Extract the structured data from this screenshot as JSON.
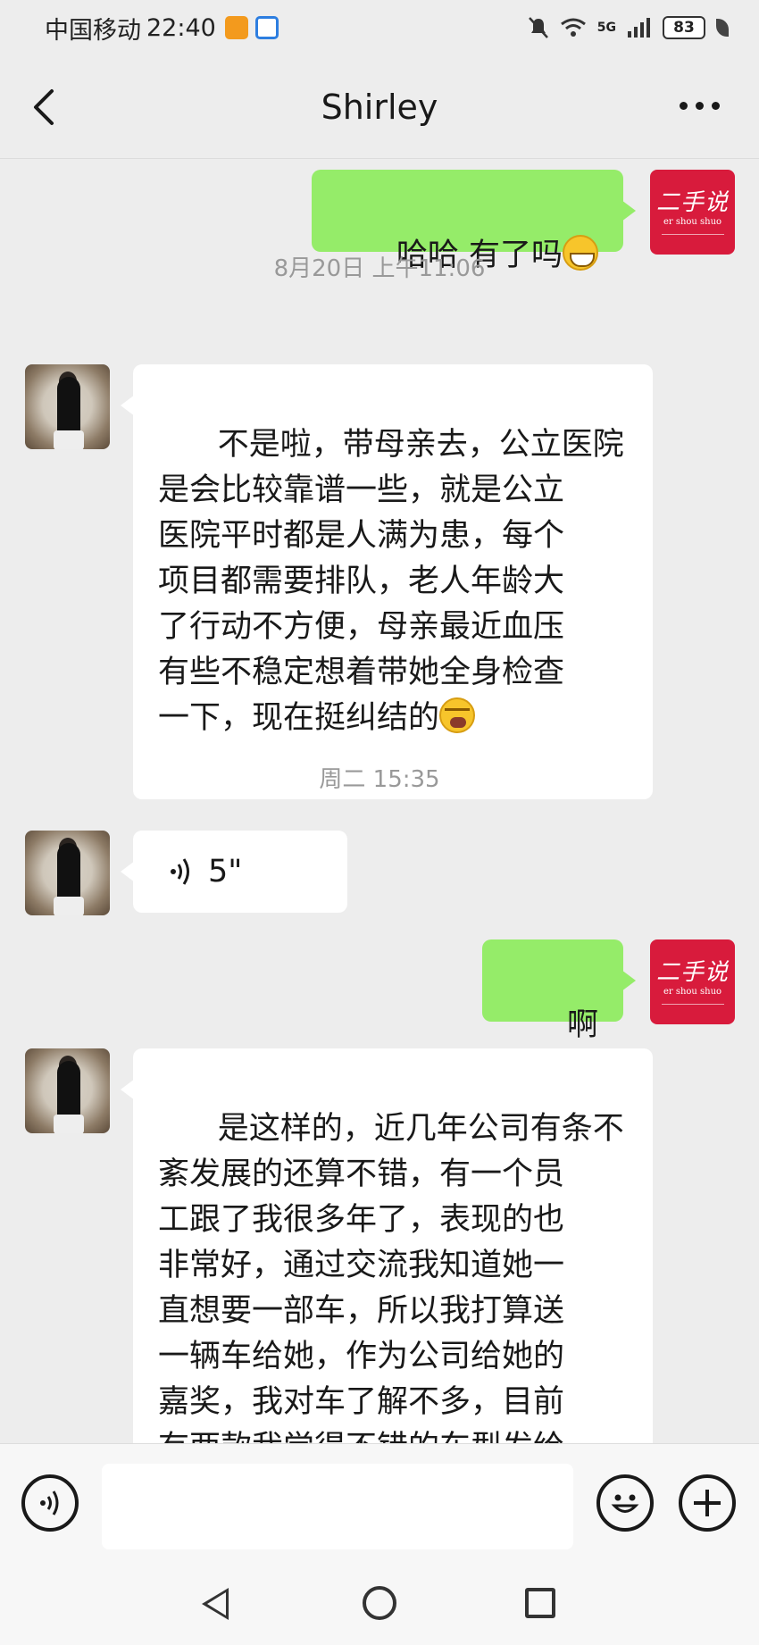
{
  "status_bar": {
    "carrier": "中国移动",
    "time": "22:40",
    "network": "5G",
    "battery": "83"
  },
  "header": {
    "title": "Shirley"
  },
  "brand_avatar": {
    "text_main": "二手说",
    "text_sub": "er shou shuo"
  },
  "messages": [
    {
      "id": "m1",
      "side": "me",
      "type": "text",
      "text": "哈哈 有了吗",
      "emoji": "grin-icon"
    },
    {
      "id": "t1",
      "type": "timestamp",
      "text": "8月20日 上午11:06"
    },
    {
      "id": "m2",
      "side": "them",
      "type": "text",
      "text": "不是啦，带母亲去，公立医院\n是会比较靠谱一些，就是公立\n医院平时都是人满为患，每个\n项目都需要排队，老人年龄大\n了行动不方便，母亲最近血压\n有些不稳定想着带她全身检查\n一下，现在挺纠结的",
      "emoji": "cry-icon"
    },
    {
      "id": "t2",
      "type": "timestamp",
      "text": "周二 15:35"
    },
    {
      "id": "m3",
      "side": "them",
      "type": "voice",
      "duration": "5\""
    },
    {
      "id": "m4",
      "side": "me",
      "type": "text",
      "text": "啊"
    },
    {
      "id": "m5",
      "side": "them",
      "type": "text",
      "text": "是这样的，近几年公司有条不\n紊发展的还算不错，有一个员\n工跟了我很多年了，表现的也\n非常好，通过交流我知道她一\n直想要一部车，所以我打算送\n一辆车给她，作为公司给她的\n嘉奖，我对车了解不多，目前\n有两款我觉得不错的车型发给\n你看看，你觉得哪款比较好看"
    }
  ],
  "input_bar": {
    "voice_icon": "voice-input-icon",
    "emoji_icon": "emoji-smile-icon",
    "plus_icon": "plus-icon"
  },
  "colors": {
    "background": "#ededed",
    "my_bubble": "#95ec69",
    "their_bubble": "#ffffff",
    "brand_red": "#d81b3c"
  }
}
